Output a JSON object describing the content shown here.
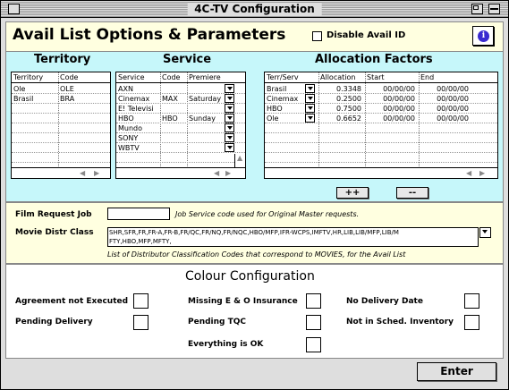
{
  "window": {
    "title": "4C-TV Configuration"
  },
  "header": {
    "title": "Avail List Options & Parameters",
    "disable_avail_id_label": "Disable Avail ID",
    "disable_avail_id_checked": false
  },
  "territory": {
    "heading": "Territory",
    "columns": [
      "Territory",
      "Code"
    ],
    "rows": [
      {
        "territory": "Ole",
        "code": "OLE"
      },
      {
        "territory": "Brasil",
        "code": "BRA"
      }
    ]
  },
  "service": {
    "heading": "Service",
    "columns": [
      "Service",
      "Code",
      "Premiere"
    ],
    "rows": [
      {
        "service": "AXN",
        "code": "",
        "premiere": ""
      },
      {
        "service": "Cinemax",
        "code": "MAX",
        "premiere": "Saturday"
      },
      {
        "service": "E! Televisi",
        "code": "",
        "premiere": ""
      },
      {
        "service": "HBO",
        "code": "HBO",
        "premiere": "Sunday"
      },
      {
        "service": "Mundo",
        "code": "",
        "premiere": ""
      },
      {
        "service": "SONY",
        "code": "",
        "premiere": ""
      },
      {
        "service": "WBTV",
        "code": "",
        "premiere": ""
      }
    ]
  },
  "allocation": {
    "heading": "Allocation Factors",
    "columns": [
      "Terr/Serv",
      "Allocation",
      "Start",
      "End"
    ],
    "rows": [
      {
        "terr_serv": "Brasil",
        "allocation": "0.3348",
        "start": "00/00/00",
        "end": "00/00/00"
      },
      {
        "terr_serv": "Cinemax",
        "allocation": "0.2500",
        "start": "00/00/00",
        "end": "00/00/00"
      },
      {
        "terr_serv": "HBO",
        "allocation": "0.7500",
        "start": "00/00/00",
        "end": "00/00/00"
      },
      {
        "terr_serv": "Ole",
        "allocation": "0.6652",
        "start": "00/00/00",
        "end": "00/00/00"
      }
    ],
    "plus_label": "++",
    "minus_label": "--"
  },
  "film_request": {
    "label": "Film Request Job",
    "value": "",
    "hint": "Job Service code used for Original Master requests."
  },
  "movie_distr": {
    "label": "Movie Distr Class",
    "value_line1": "SHR,SFR,FR,FR-A,FR-B,FR/QC,FR/NQ,FR/NQC,HBO/MFP,IFR-WCPS,IMFTV,HR,LIB,LIB/MFP,LIB/M",
    "value_line2": "FTY,HBO,MFP,MFTY,",
    "hint": "List of Distributor Classification Codes that correspond to MOVIES, for the Avail List"
  },
  "colour": {
    "heading": "Colour Configuration",
    "items": {
      "agreement": "Agreement not Executed",
      "missing_eo": "Missing E & O Insurance",
      "no_delivery": "No Delivery Date",
      "pending_delivery": "Pending Delivery",
      "pending_tqc": "Pending TQC",
      "not_in_sched": "Not in Sched. Inventory",
      "everything_ok": "Everything is OK"
    }
  },
  "footer": {
    "enter_label": "Enter"
  },
  "icons": [
    "close-box-icon",
    "zoom-box-icon",
    "collapse-box-icon",
    "info-icon",
    "dropdown-arrow-icon",
    "scroll-left-icon",
    "scroll-right-icon",
    "scroll-up-icon",
    "scroll-down-icon"
  ],
  "colors": {
    "header_bg": "#ffffe0",
    "tables_bg": "#c6f7fa",
    "info_icon": "#3a2bd0"
  }
}
